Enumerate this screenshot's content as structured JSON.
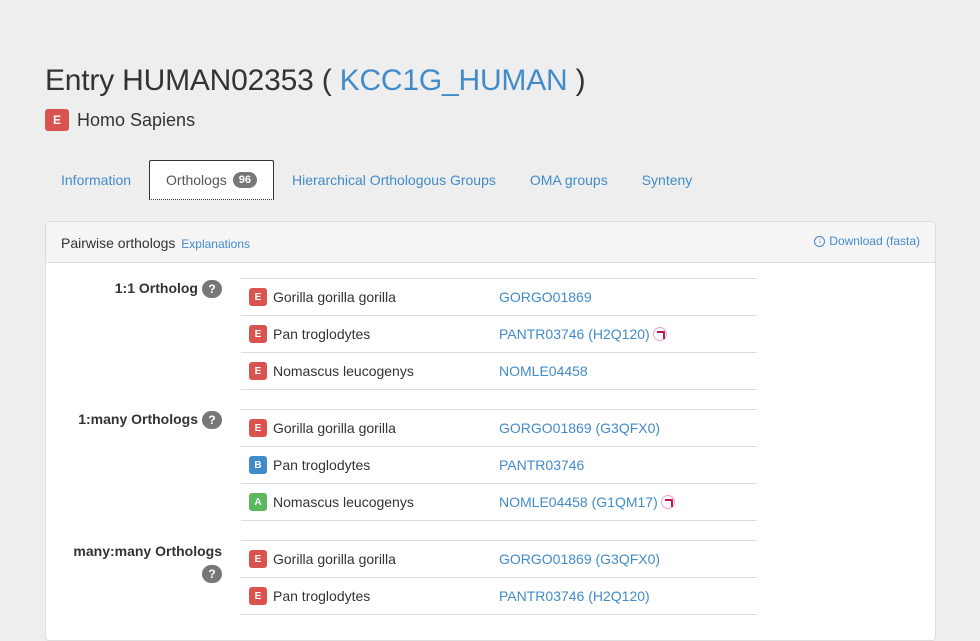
{
  "entry": {
    "title_prefix": "Entry HUMAN02353 ( ",
    "title_link": "KCC1G_HUMAN",
    "title_suffix": " )",
    "species_badge": "E",
    "species": "Homo Sapiens"
  },
  "tabs": [
    {
      "label": "Information",
      "active": false
    },
    {
      "label": "Orthologs",
      "count": "96",
      "active": true
    },
    {
      "label": "Hierarchical Orthologous Groups",
      "active": false
    },
    {
      "label": "OMA groups",
      "active": false
    },
    {
      "label": "Synteny",
      "active": false
    }
  ],
  "panel": {
    "title": "Pairwise orthologs",
    "explanations": "Explanations",
    "download": "Download (fasta)"
  },
  "groups": [
    {
      "label": "1:1 Ortholog",
      "help": "?",
      "rows": [
        {
          "tag": "E",
          "species": "Gorilla gorilla gorilla",
          "id": "GORGO01869"
        },
        {
          "tag": "E",
          "species": "Pan troglodytes",
          "id": "PANTR03746 (H2Q120)",
          "xref_icon": true
        },
        {
          "tag": "E",
          "species": "Nomascus leucogenys",
          "id": "NOMLE04458"
        }
      ]
    },
    {
      "label": "1:many Orthologs",
      "help": "?",
      "rows": [
        {
          "tag": "E",
          "species": "Gorilla gorilla gorilla",
          "id": "GORGO01869 (G3QFX0)"
        },
        {
          "tag": "B",
          "species": "Pan troglodytes",
          "id": "PANTR03746"
        },
        {
          "tag": "A",
          "species": "Nomascus leucogenys",
          "id": "NOMLE04458 (G1QM17)",
          "xref_icon": true
        }
      ]
    },
    {
      "label": "many:many Orthologs",
      "help": "?",
      "rows": [
        {
          "tag": "E",
          "species": "Gorilla gorilla gorilla",
          "id": "GORGO01869 (G3QFX0)"
        },
        {
          "tag": "E",
          "species": "Pan troglodytes",
          "id": "PANTR03746 (H2Q120)"
        }
      ]
    }
  ],
  "colors": {
    "link": "#428bca",
    "tag_E": "#d9534f",
    "tag_B": "#428bca",
    "tag_A": "#5cb85c"
  }
}
